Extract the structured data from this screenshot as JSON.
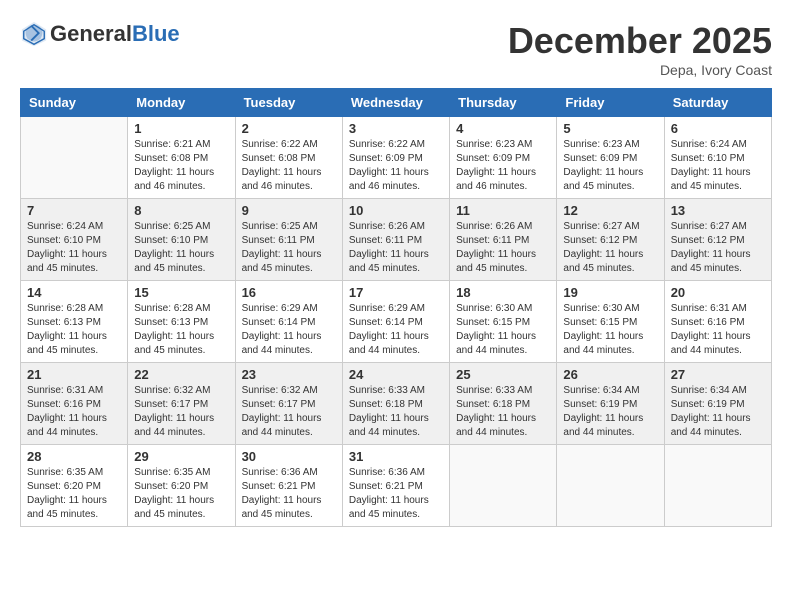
{
  "header": {
    "logo_general": "General",
    "logo_blue": "Blue",
    "month": "December 2025",
    "location": "Depa, Ivory Coast"
  },
  "weekdays": [
    "Sunday",
    "Monday",
    "Tuesday",
    "Wednesday",
    "Thursday",
    "Friday",
    "Saturday"
  ],
  "weeks": [
    [
      {
        "day": "",
        "sunrise": "",
        "sunset": "",
        "daylight": ""
      },
      {
        "day": "1",
        "sunrise": "Sunrise: 6:21 AM",
        "sunset": "Sunset: 6:08 PM",
        "daylight": "Daylight: 11 hours and 46 minutes."
      },
      {
        "day": "2",
        "sunrise": "Sunrise: 6:22 AM",
        "sunset": "Sunset: 6:08 PM",
        "daylight": "Daylight: 11 hours and 46 minutes."
      },
      {
        "day": "3",
        "sunrise": "Sunrise: 6:22 AM",
        "sunset": "Sunset: 6:09 PM",
        "daylight": "Daylight: 11 hours and 46 minutes."
      },
      {
        "day": "4",
        "sunrise": "Sunrise: 6:23 AM",
        "sunset": "Sunset: 6:09 PM",
        "daylight": "Daylight: 11 hours and 46 minutes."
      },
      {
        "day": "5",
        "sunrise": "Sunrise: 6:23 AM",
        "sunset": "Sunset: 6:09 PM",
        "daylight": "Daylight: 11 hours and 45 minutes."
      },
      {
        "day": "6",
        "sunrise": "Sunrise: 6:24 AM",
        "sunset": "Sunset: 6:10 PM",
        "daylight": "Daylight: 11 hours and 45 minutes."
      }
    ],
    [
      {
        "day": "7",
        "sunrise": "Sunrise: 6:24 AM",
        "sunset": "Sunset: 6:10 PM",
        "daylight": "Daylight: 11 hours and 45 minutes."
      },
      {
        "day": "8",
        "sunrise": "Sunrise: 6:25 AM",
        "sunset": "Sunset: 6:10 PM",
        "daylight": "Daylight: 11 hours and 45 minutes."
      },
      {
        "day": "9",
        "sunrise": "Sunrise: 6:25 AM",
        "sunset": "Sunset: 6:11 PM",
        "daylight": "Daylight: 11 hours and 45 minutes."
      },
      {
        "day": "10",
        "sunrise": "Sunrise: 6:26 AM",
        "sunset": "Sunset: 6:11 PM",
        "daylight": "Daylight: 11 hours and 45 minutes."
      },
      {
        "day": "11",
        "sunrise": "Sunrise: 6:26 AM",
        "sunset": "Sunset: 6:11 PM",
        "daylight": "Daylight: 11 hours and 45 minutes."
      },
      {
        "day": "12",
        "sunrise": "Sunrise: 6:27 AM",
        "sunset": "Sunset: 6:12 PM",
        "daylight": "Daylight: 11 hours and 45 minutes."
      },
      {
        "day": "13",
        "sunrise": "Sunrise: 6:27 AM",
        "sunset": "Sunset: 6:12 PM",
        "daylight": "Daylight: 11 hours and 45 minutes."
      }
    ],
    [
      {
        "day": "14",
        "sunrise": "Sunrise: 6:28 AM",
        "sunset": "Sunset: 6:13 PM",
        "daylight": "Daylight: 11 hours and 45 minutes."
      },
      {
        "day": "15",
        "sunrise": "Sunrise: 6:28 AM",
        "sunset": "Sunset: 6:13 PM",
        "daylight": "Daylight: 11 hours and 45 minutes."
      },
      {
        "day": "16",
        "sunrise": "Sunrise: 6:29 AM",
        "sunset": "Sunset: 6:14 PM",
        "daylight": "Daylight: 11 hours and 44 minutes."
      },
      {
        "day": "17",
        "sunrise": "Sunrise: 6:29 AM",
        "sunset": "Sunset: 6:14 PM",
        "daylight": "Daylight: 11 hours and 44 minutes."
      },
      {
        "day": "18",
        "sunrise": "Sunrise: 6:30 AM",
        "sunset": "Sunset: 6:15 PM",
        "daylight": "Daylight: 11 hours and 44 minutes."
      },
      {
        "day": "19",
        "sunrise": "Sunrise: 6:30 AM",
        "sunset": "Sunset: 6:15 PM",
        "daylight": "Daylight: 11 hours and 44 minutes."
      },
      {
        "day": "20",
        "sunrise": "Sunrise: 6:31 AM",
        "sunset": "Sunset: 6:16 PM",
        "daylight": "Daylight: 11 hours and 44 minutes."
      }
    ],
    [
      {
        "day": "21",
        "sunrise": "Sunrise: 6:31 AM",
        "sunset": "Sunset: 6:16 PM",
        "daylight": "Daylight: 11 hours and 44 minutes."
      },
      {
        "day": "22",
        "sunrise": "Sunrise: 6:32 AM",
        "sunset": "Sunset: 6:17 PM",
        "daylight": "Daylight: 11 hours and 44 minutes."
      },
      {
        "day": "23",
        "sunrise": "Sunrise: 6:32 AM",
        "sunset": "Sunset: 6:17 PM",
        "daylight": "Daylight: 11 hours and 44 minutes."
      },
      {
        "day": "24",
        "sunrise": "Sunrise: 6:33 AM",
        "sunset": "Sunset: 6:18 PM",
        "daylight": "Daylight: 11 hours and 44 minutes."
      },
      {
        "day": "25",
        "sunrise": "Sunrise: 6:33 AM",
        "sunset": "Sunset: 6:18 PM",
        "daylight": "Daylight: 11 hours and 44 minutes."
      },
      {
        "day": "26",
        "sunrise": "Sunrise: 6:34 AM",
        "sunset": "Sunset: 6:19 PM",
        "daylight": "Daylight: 11 hours and 44 minutes."
      },
      {
        "day": "27",
        "sunrise": "Sunrise: 6:34 AM",
        "sunset": "Sunset: 6:19 PM",
        "daylight": "Daylight: 11 hours and 44 minutes."
      }
    ],
    [
      {
        "day": "28",
        "sunrise": "Sunrise: 6:35 AM",
        "sunset": "Sunset: 6:20 PM",
        "daylight": "Daylight: 11 hours and 45 minutes."
      },
      {
        "day": "29",
        "sunrise": "Sunrise: 6:35 AM",
        "sunset": "Sunset: 6:20 PM",
        "daylight": "Daylight: 11 hours and 45 minutes."
      },
      {
        "day": "30",
        "sunrise": "Sunrise: 6:36 AM",
        "sunset": "Sunset: 6:21 PM",
        "daylight": "Daylight: 11 hours and 45 minutes."
      },
      {
        "day": "31",
        "sunrise": "Sunrise: 6:36 AM",
        "sunset": "Sunset: 6:21 PM",
        "daylight": "Daylight: 11 hours and 45 minutes."
      },
      {
        "day": "",
        "sunrise": "",
        "sunset": "",
        "daylight": ""
      },
      {
        "day": "",
        "sunrise": "",
        "sunset": "",
        "daylight": ""
      },
      {
        "day": "",
        "sunrise": "",
        "sunset": "",
        "daylight": ""
      }
    ]
  ]
}
